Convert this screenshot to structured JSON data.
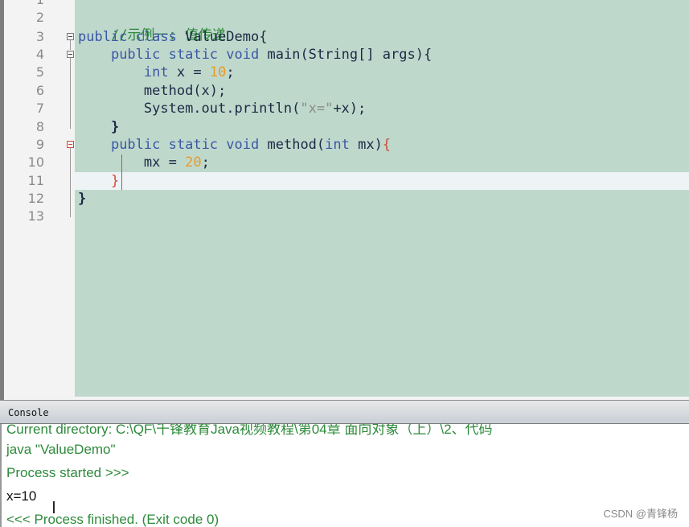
{
  "editor": {
    "line_numbers": [
      "1",
      "2",
      "3",
      "4",
      "5",
      "6",
      "7",
      "8",
      "9",
      "10",
      "11",
      "12",
      "13"
    ],
    "lines": {
      "l2_comment": "//示例一: 值传递",
      "l3_kw1": "public",
      "l3_kw2": "class",
      "l3_rest": "ValueDemo{",
      "l4_kw1": "public",
      "l4_kw2": "static",
      "l4_kw3": "void",
      "l4_rest": "main(String[] args){",
      "l5_kw": "int",
      "l5_mid": "x =",
      "l5_num": "10",
      "l5_end": ";",
      "l6": "method(x);",
      "l7_a": "System.out.println(",
      "l7_str": "\"x=\"",
      "l7_b": "+x);",
      "l8": "}",
      "l9_kw1": "public",
      "l9_kw2": "static",
      "l9_kw3": "void",
      "l9_mid": "method(",
      "l9_kw4": "int",
      "l9_rest": "mx)",
      "l9_brace": "{",
      "l10_a": "mx =",
      "l10_num": "20",
      "l10_end": ";",
      "l11": "}",
      "l12": "}"
    },
    "colors": {
      "background": "#bfd8cc",
      "keyword": "#3b58a5",
      "comment": "#2d8a3a",
      "number": "#e79b2a",
      "brace_match": "#d04a3a"
    }
  },
  "console": {
    "title": "Console",
    "lines": [
      "Current directory: C:\\QF\\千锋教育Java视频教程\\第04章 面向对象（上）\\2、代码",
      "java \"ValueDemo\"",
      "Process started >>>",
      "x=10",
      "<<< Process finished. (Exit code 0)"
    ]
  },
  "watermark": "CSDN @青锋杨"
}
